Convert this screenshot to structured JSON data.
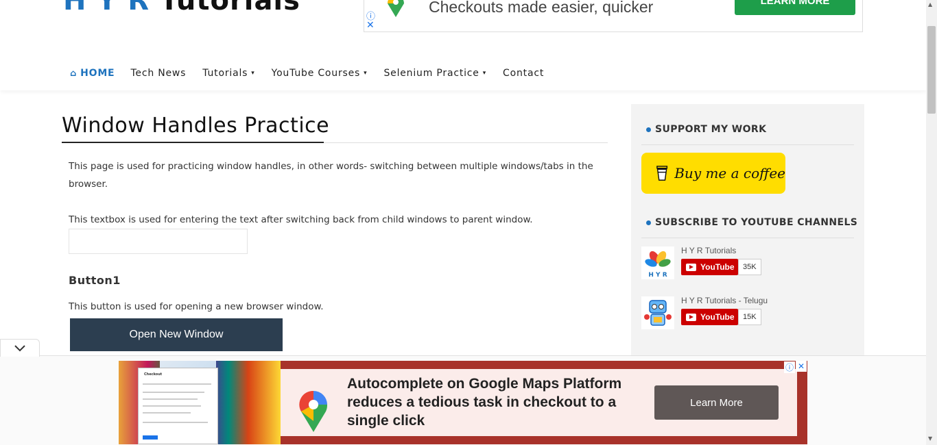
{
  "header": {
    "logo_primary": "H Y R",
    "logo_secondary": "Tutorials"
  },
  "top_ad": {
    "text": "Checkouts made easier, quicker",
    "button": "LEARN MORE"
  },
  "nav": {
    "items": [
      {
        "label": "HOME",
        "active": true,
        "has_dropdown": false
      },
      {
        "label": "Tech News",
        "active": false,
        "has_dropdown": false
      },
      {
        "label": "Tutorials",
        "active": false,
        "has_dropdown": true
      },
      {
        "label": "YouTube Courses",
        "active": false,
        "has_dropdown": true
      },
      {
        "label": "Selenium Practice",
        "active": false,
        "has_dropdown": true
      },
      {
        "label": "Contact",
        "active": false,
        "has_dropdown": false
      }
    ]
  },
  "main": {
    "title": "Window Handles Practice",
    "intro": "This page is used for practicing window handles, in other words- switching between multiple windows/tabs in the browser.",
    "textbox_desc": "This textbox is used for entering the text after switching back from child windows to parent window.",
    "textbox_value": "",
    "button1_heading": "Button1",
    "button1_desc": "This button is used for opening a new browser window.",
    "button1_label": "Open New Window"
  },
  "sidebar": {
    "support_title": "SUPPORT MY WORK",
    "coffee_label": "Buy me a coffee",
    "subscribe_title": "SUBSCRIBE TO YOUTUBE CHANNELS",
    "channels": [
      {
        "name": "H Y R Tutorials",
        "button": "YouTube",
        "count": "35K"
      },
      {
        "name": "H Y R Tutorials - Telugu",
        "button": "YouTube",
        "count": "15K"
      }
    ]
  },
  "bottom_ad": {
    "headline": "Autocomplete on Google Maps Platform reduces a tedious task in checkout to a single click",
    "button": "Learn More",
    "phone_title": "Checkout"
  },
  "colors": {
    "accent": "#1e73be",
    "button_dark": "#2c3e50",
    "coffee_yellow": "#ffdd00",
    "youtube_red": "#cc0000",
    "ad_green": "#1e9e4a"
  }
}
